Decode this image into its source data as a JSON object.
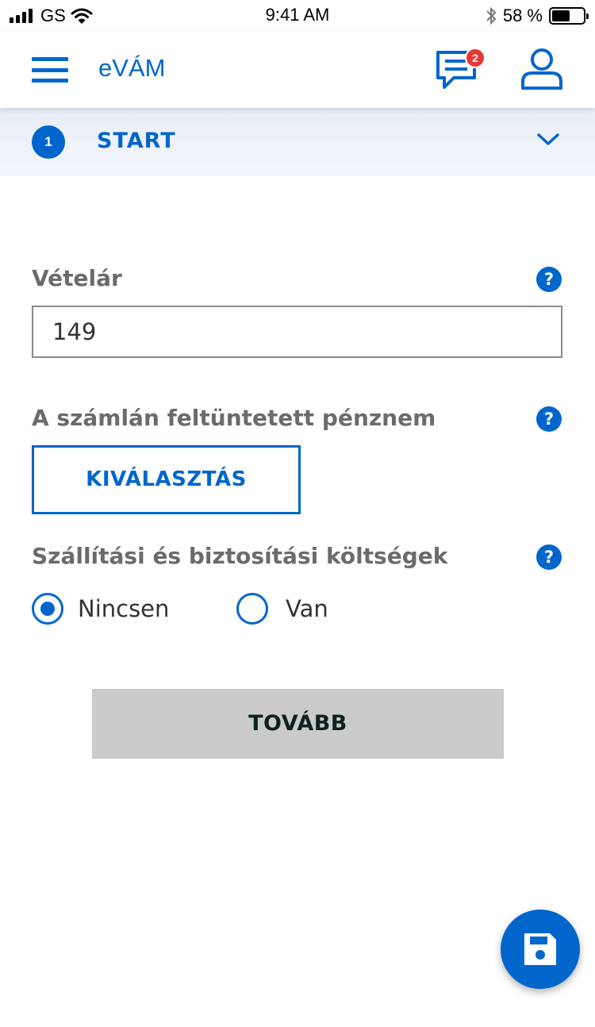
{
  "status_bar": {
    "carrier": "GS",
    "time": "9:41 AM",
    "battery_percent": "58 %",
    "battery_level": 0.58
  },
  "header": {
    "title": "eVÁM",
    "message_badge": "2",
    "icons": [
      "menu-icon",
      "messages-icon",
      "user-icon"
    ]
  },
  "stepper": {
    "step_number": "1",
    "step_label": "START"
  },
  "form": {
    "purchase_price": {
      "label": "Vételár",
      "value": "149"
    },
    "currency": {
      "label": "A számlán feltüntetett pénznem",
      "button_label": "KIVÁLASZTÁS"
    },
    "shipping": {
      "label": "Szállítási és biztosítási költségek",
      "options": [
        {
          "label": "Nincsen",
          "selected": true
        },
        {
          "label": "Van",
          "selected": false
        }
      ]
    },
    "next_label": "TOVÁBB"
  },
  "colors": {
    "accent": "#0066cc",
    "badge": "#e53935",
    "disabled_button": "#cbcbcb"
  }
}
